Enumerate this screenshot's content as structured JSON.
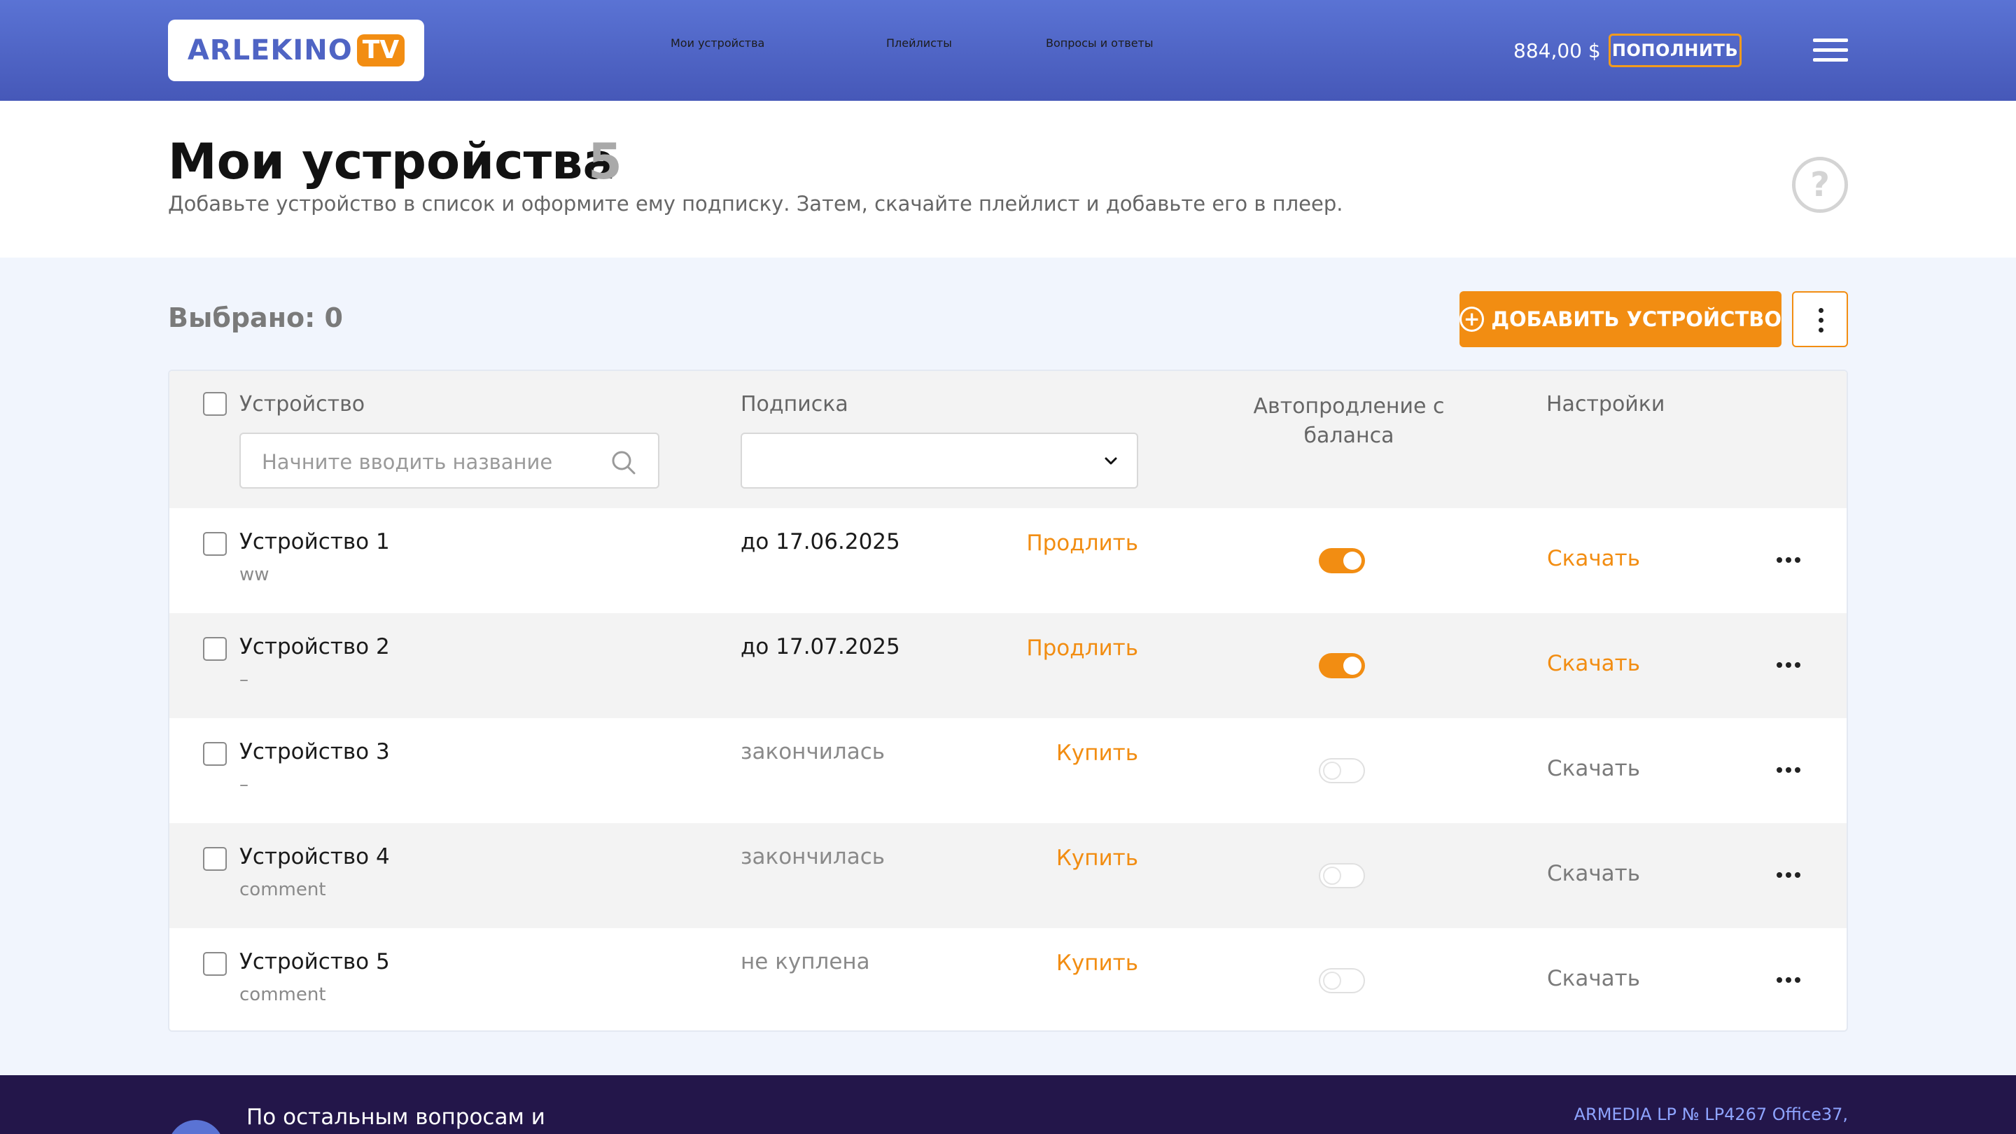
{
  "header": {
    "logo": {
      "text": "ARLEKINO",
      "badge": "TV"
    },
    "nav": [
      {
        "label": "Мои устройства"
      },
      {
        "label": "Плейлисты"
      },
      {
        "label": "Вопросы и ответы"
      }
    ],
    "balance": "884,00 $",
    "topup_label": "ПОПОЛНИТЬ",
    "menu_icon": "hamburger-icon"
  },
  "page": {
    "title": "Мои устройства",
    "count": "5",
    "subtitle": "Добавьте устройство в список и оформите ему подписку. Затем, скачайте плейлист и добавьте его в плеер.",
    "help_icon": "question-circle-icon"
  },
  "toolbar": {
    "selected_label": "Выбрано: 0",
    "add_device_label": "ДОБАВИТЬ УСТРОЙСТВО",
    "add_icon": "plus-circle-icon",
    "more_icon": "vertical-dots-icon"
  },
  "table": {
    "headers": {
      "device": "Устройство",
      "subscription": "Подписка",
      "autorenew": "Автопродление с баланса",
      "settings": "Настройки"
    },
    "search_placeholder": "Начните вводить название",
    "subscription_filter_value": "",
    "rows": [
      {
        "name": "Устройство 1",
        "comment": "ww",
        "subscription": "до 17.06.2025",
        "subscription_active": true,
        "action": "Продлить",
        "autorenew": true,
        "download": "Скачать"
      },
      {
        "name": "Устройство 2",
        "comment": "–",
        "subscription": "до 17.07.2025",
        "subscription_active": true,
        "action": "Продлить",
        "autorenew": true,
        "download": "Скачать"
      },
      {
        "name": "Устройство 3",
        "comment": "–",
        "subscription": "закончилась",
        "subscription_active": false,
        "action": "Купить",
        "autorenew": false,
        "download": "Скачать"
      },
      {
        "name": "Устройство 4",
        "comment": "comment",
        "subscription": "закончилась",
        "subscription_active": false,
        "action": "Купить",
        "autorenew": false,
        "download": "Скачать"
      },
      {
        "name": "Устройство 5",
        "comment": "comment",
        "subscription": "не куплена",
        "subscription_active": false,
        "action": "Купить",
        "autorenew": false,
        "download": "Скачать"
      }
    ]
  },
  "footer": {
    "text": "По остальным вопросам и",
    "legal": "ARMEDIA LP № LP4267 Office37,"
  },
  "colors": {
    "accent": "#f28d12",
    "header_start": "#5a73d4",
    "header_end": "#4658b8",
    "footer": "#23164a"
  }
}
